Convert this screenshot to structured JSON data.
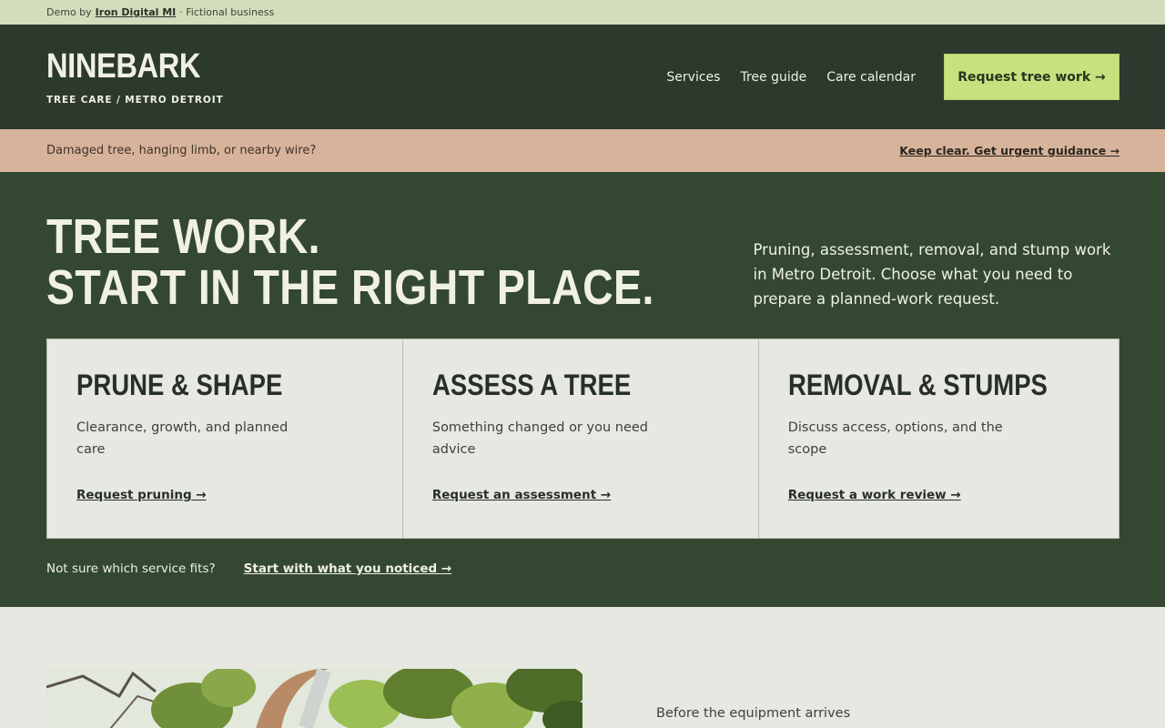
{
  "demo_bar": {
    "prefix": "Demo by",
    "link": "Iron Digital MI",
    "suffix": "· Fictional business"
  },
  "header": {
    "brand": "NINEBARK",
    "tagline": "TREE CARE / METRO DETROIT",
    "nav": [
      "Services",
      "Tree guide",
      "Care calendar"
    ],
    "cta": "Request tree work →"
  },
  "alert": {
    "text": "Damaged tree, hanging limb, or nearby wire?",
    "link": "Keep clear. Get urgent guidance →"
  },
  "hero": {
    "title_line1": "TREE WORK.",
    "title_line2": "START IN THE RIGHT PLACE.",
    "description": "Pruning, assessment, removal, and stump work in Metro Detroit. Choose what you need to prepare a planned-work request."
  },
  "cards": [
    {
      "title": "PRUNE & SHAPE",
      "desc": "Clearance, growth, and planned care",
      "link": "Request pruning →"
    },
    {
      "title": "ASSESS A TREE",
      "desc": "Something changed or you need advice",
      "link": "Request an assessment →"
    },
    {
      "title": "REMOVAL & STUMPS",
      "desc": "Discuss access, options, and the scope",
      "link": "Request a work review →"
    }
  ],
  "hero_foot": {
    "text": "Not sure which service fits?",
    "link": "Start with what you noticed →"
  },
  "lower": {
    "label": "Before the equipment arrives"
  },
  "colors": {
    "dark_green": "#2c3a2e",
    "hero_green": "#344831",
    "lime": "#c9e07e",
    "alert_peach": "#d8b39b"
  }
}
